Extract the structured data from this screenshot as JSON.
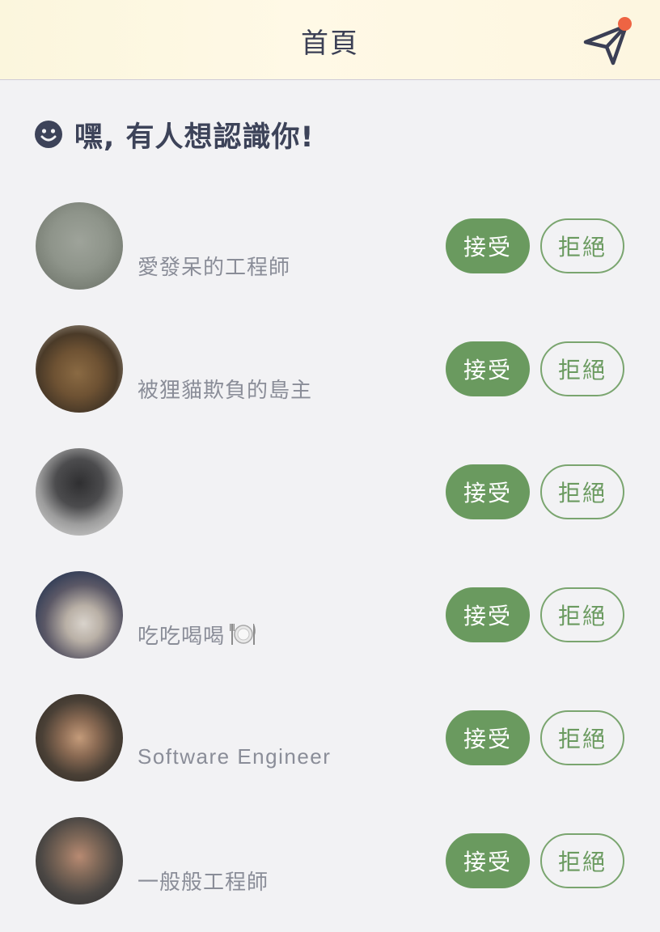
{
  "header": {
    "title": "首頁"
  },
  "section": {
    "title": "嘿, 有人想認識你!"
  },
  "requests": [
    {
      "name": "愛發呆的工程師",
      "accept_label": "接受",
      "reject_label": "拒絕"
    },
    {
      "name": "被狸貓欺負的島主",
      "accept_label": "接受",
      "reject_label": "拒絕"
    },
    {
      "name": "",
      "accept_label": "接受",
      "reject_label": "拒絕"
    },
    {
      "name": "吃吃喝喝",
      "accept_label": "接受",
      "reject_label": "拒絕"
    },
    {
      "name": "Software Engineer",
      "accept_label": "接受",
      "reject_label": "拒絕"
    },
    {
      "name": "一般般工程師",
      "accept_label": "接受",
      "reject_label": "拒絕"
    }
  ],
  "icons": {
    "send": "paper-plane-icon",
    "section": "smile-icon",
    "emoji": "fork-knife-plate-icon"
  },
  "colors": {
    "accent_green": "#6a9a5f",
    "notification": "#ee6443",
    "header_bg": "#fcf6df",
    "page_bg": "#f2f2f4",
    "title_text": "#3d4359",
    "name_text": "#8a8d98"
  }
}
